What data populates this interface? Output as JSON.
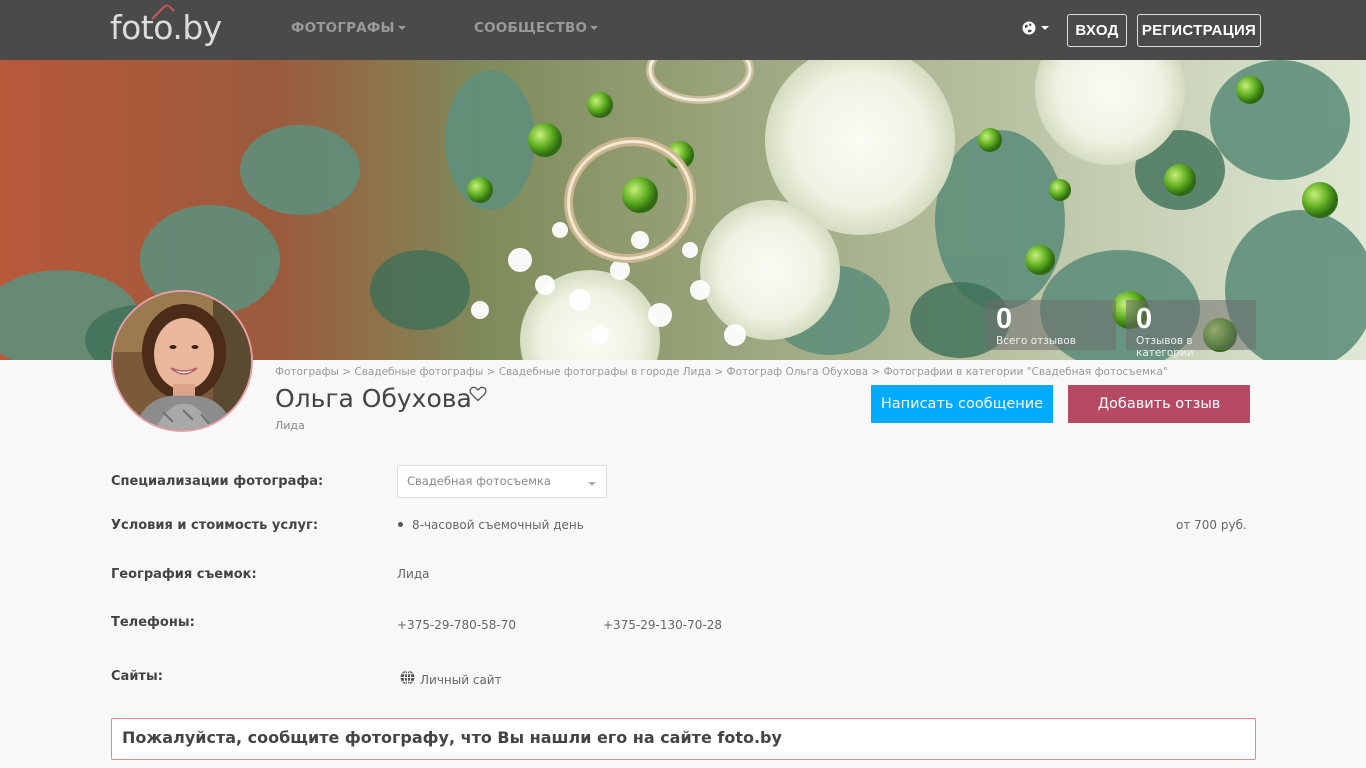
{
  "navbar": {
    "logo": "foto.by",
    "menu": [
      {
        "label": "ФОТОГРАФЫ"
      },
      {
        "label": "СООБЩЕСТВО"
      }
    ],
    "login": "ВХОД",
    "register": "РЕГИСТРАЦИЯ"
  },
  "stats": [
    {
      "count": "0",
      "label": "Всего отзывов"
    },
    {
      "count": "0",
      "label": "Отзывов в категории"
    }
  ],
  "breadcrumb": "Фотографы > Свадебные фотографы > Свадебные фотографы в городе Лида > Фотограф Ольга Обухова > Фотографии в категории \"Свадебная фотосъемка\"",
  "profile": {
    "name": "Ольга Обухова",
    "city": "Лида"
  },
  "actions": {
    "message": "Написать сообщение",
    "review": "Добавить отзыв"
  },
  "info": {
    "spec_label": "Специализации фотографа:",
    "spec_value": "Свадебная фотосъемка",
    "terms_label": "Условия и стоимость услуг:",
    "terms_item": "8-часовой съемочный день",
    "terms_price": "от 700 руб.",
    "geo_label": "География съемок:",
    "geo_value": "Лида",
    "phones_label": "Телефоны:",
    "phone1": "+375-29-780-58-70",
    "phone2": "+375-29-130-70-28",
    "sites_label": "Сайты:",
    "site": "Личный сайт"
  },
  "notice": "Пожалуйста, сообщите фотографу, что Вы нашли его на сайте foto.by",
  "colors": {
    "navbar": "#4a4a4a",
    "message_button": "#00aaff",
    "review_button": "#b64a65"
  }
}
